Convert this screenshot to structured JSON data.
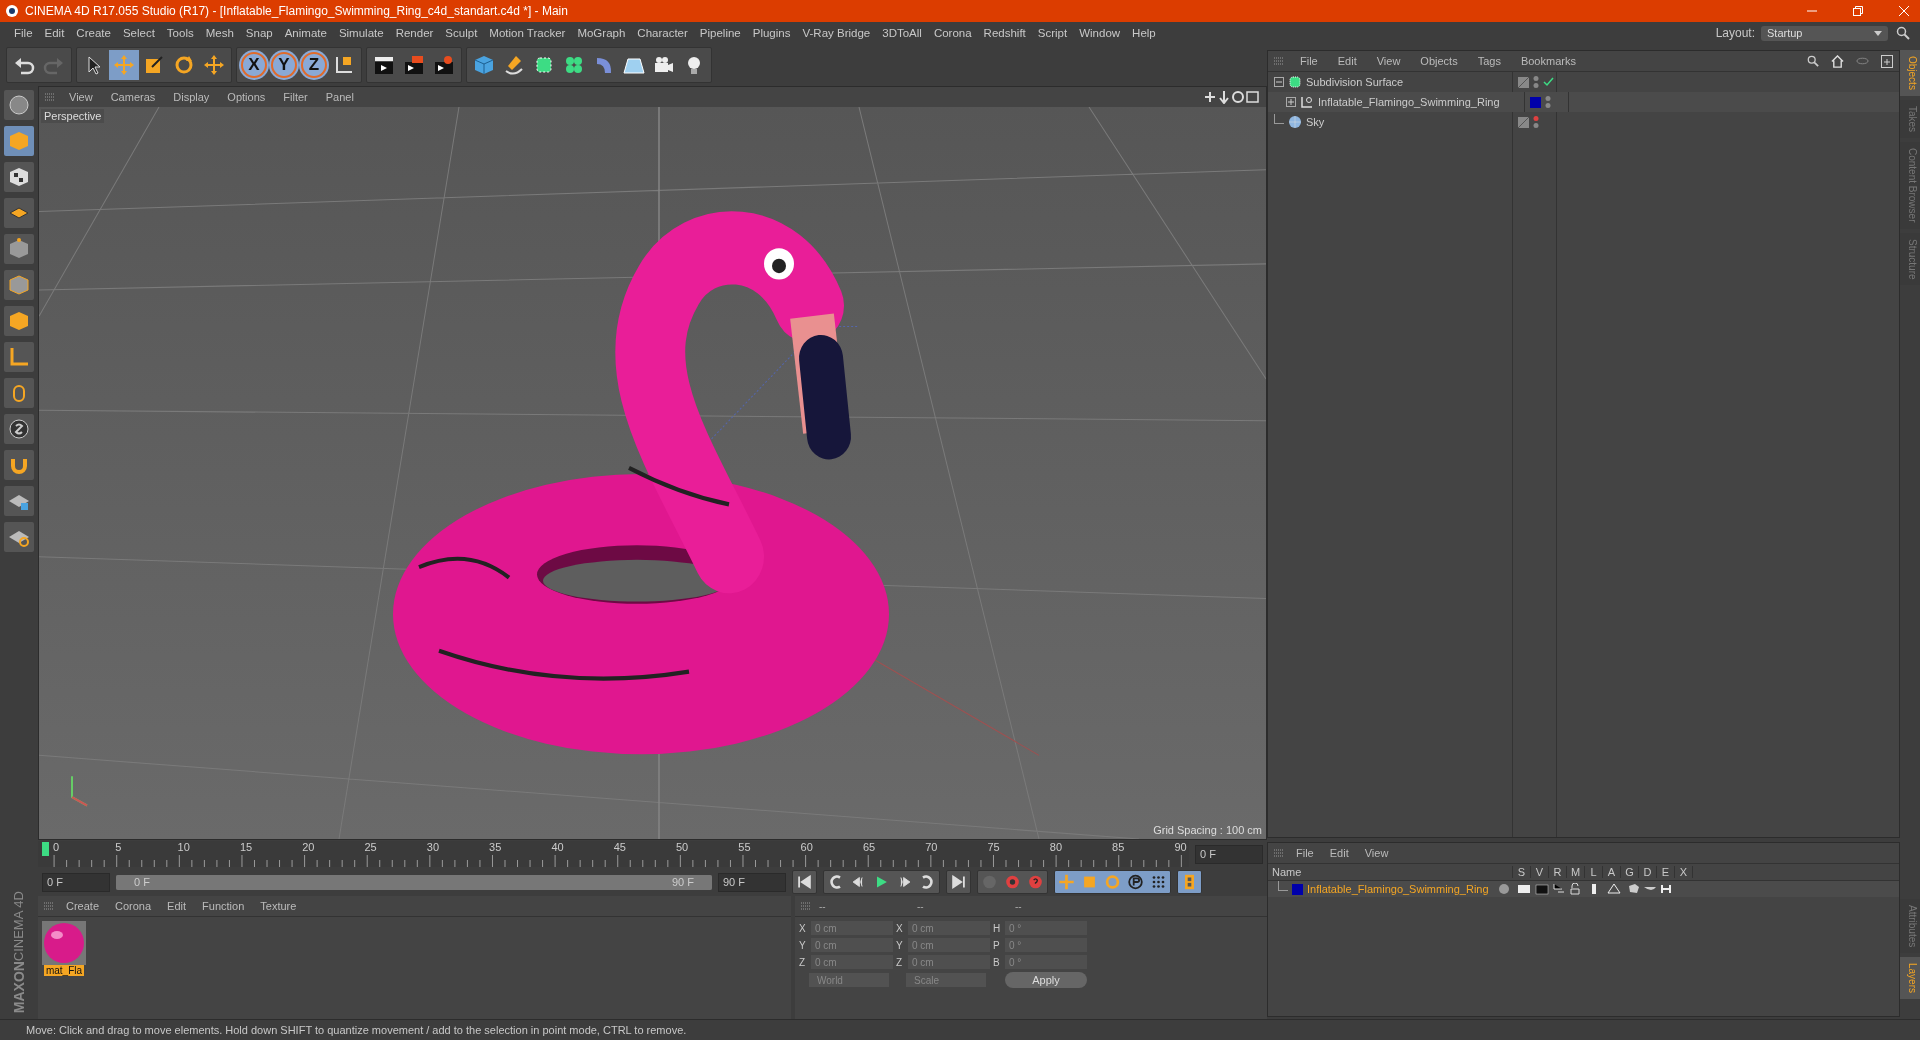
{
  "window": {
    "title": "CINEMA 4D R17.055 Studio (R17) - [Inflatable_Flamingo_Swimming_Ring_c4d_standart.c4d *] - Main"
  },
  "menu": [
    "File",
    "Edit",
    "Create",
    "Select",
    "Tools",
    "Mesh",
    "Snap",
    "Animate",
    "Simulate",
    "Render",
    "Sculpt",
    "Motion Tracker",
    "MoGraph",
    "Character",
    "Pipeline",
    "Plugins",
    "V-Ray Bridge",
    "3DToAll",
    "Corona",
    "Redshift",
    "Script",
    "Window",
    "Help"
  ],
  "layout": {
    "label": "Layout:",
    "value": "Startup"
  },
  "toolbar": {
    "tools": [
      {
        "kind": "select",
        "selected": false
      },
      {
        "kind": "move",
        "selected": true
      },
      {
        "kind": "scale",
        "selected": false
      },
      {
        "kind": "rotate",
        "selected": false
      },
      {
        "kind": "move",
        "selected": false
      }
    ],
    "axis_locks": [
      {
        "label": "X",
        "selected": true
      },
      {
        "label": "Y",
        "selected": true
      },
      {
        "label": "Z",
        "selected": true
      }
    ]
  },
  "viewport": {
    "menu": [
      "View",
      "Cameras",
      "Display",
      "Options",
      "Filter",
      "Panel"
    ],
    "camera": "Perspective",
    "grid_spacing": "Grid Spacing : 100 cm"
  },
  "timeline": {
    "ticks": [
      "0",
      "5",
      "10",
      "15",
      "20",
      "25",
      "30",
      "35",
      "40",
      "45",
      "50",
      "55",
      "60",
      "65",
      "70",
      "75",
      "80",
      "85",
      "90"
    ],
    "playhead": {
      "level": 0
    },
    "current_frame": "0 F",
    "start_field": "0 F",
    "range": {
      "start": "0 F",
      "end": "90 F",
      "level": 1
    },
    "end_field": "90 F"
  },
  "materials": {
    "menu": [
      "Create",
      "Corona",
      "Edit",
      "Function",
      "Texture"
    ],
    "items": [
      {
        "name": "mat_Fla",
        "selected": true
      }
    ]
  },
  "coordinates": {
    "headers": [
      "--",
      "--",
      "--"
    ],
    "rows": [
      {
        "axis": "X",
        "position": "0 cm",
        "size_axis": "X",
        "size": "0 cm",
        "rot_axis": "H",
        "rotation": "0 °"
      },
      {
        "axis": "Y",
        "position": "0 cm",
        "size_axis": "Y",
        "size": "0 cm",
        "rot_axis": "P",
        "rotation": "0 °"
      },
      {
        "axis": "Z",
        "position": "0 cm",
        "size_axis": "Z",
        "size": "0 cm",
        "rot_axis": "B",
        "rotation": "0 °"
      }
    ],
    "mode": "World",
    "transform": "Scale",
    "apply": "Apply"
  },
  "objects": {
    "menu": [
      "File",
      "Edit",
      "View",
      "Objects",
      "Tags",
      "Bookmarks"
    ],
    "tree": [
      {
        "name": "Subdivision Surface",
        "kind": "generator",
        "expanded": true,
        "children": [
          {
            "name": "Inflatable_Flamingo_Swimming_Ring",
            "kind": "polygon",
            "expanded": false,
            "color": "#0000aa"
          }
        ]
      },
      {
        "name": "Sky",
        "kind": "sky"
      }
    ]
  },
  "layers": {
    "menu": [
      "File",
      "Edit",
      "View"
    ],
    "columns": [
      "Name",
      "S",
      "V",
      "R",
      "M",
      "L",
      "A",
      "G",
      "D",
      "E",
      "X"
    ],
    "rows": [
      {
        "name": "Inflatable_Flamingo_Swimming_Ring",
        "color": "#0000aa"
      }
    ]
  },
  "side_tabs_top": [
    {
      "label": "Objects",
      "selected": true
    },
    {
      "label": "Takes",
      "selected": false
    },
    {
      "label": "Content Browser",
      "selected": false
    },
    {
      "label": "Structure",
      "selected": false
    }
  ],
  "side_tabs_bottom": [
    {
      "label": "Attributes",
      "selected": false
    },
    {
      "label": "Layers",
      "selected": true
    }
  ],
  "brand": {
    "line1": "MAXON",
    "line2": "CINEMA 4D"
  },
  "status_bar": "Move: Click and drag to move elements. Hold down SHIFT to quantize movement / add to the selection in point mode, CTRL to remove."
}
